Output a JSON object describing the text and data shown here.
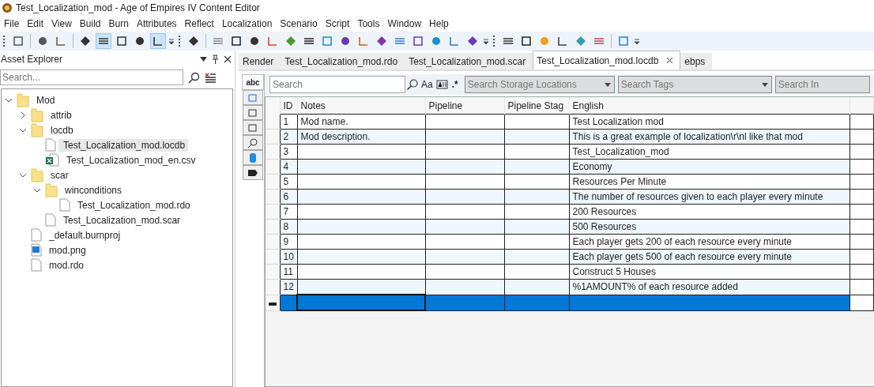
{
  "window": {
    "title": "Test_Localization_mod - Age of Empires IV Content Editor"
  },
  "menu": [
    "File",
    "Edit",
    "View",
    "Build",
    "Burn",
    "Attributes",
    "Reflect",
    "Localization",
    "Scenario",
    "Script",
    "Tools",
    "Window",
    "Help"
  ],
  "toolbar": [
    [
      {
        "pressed": false
      }
    ],
    [
      {
        "pressed": false
      },
      {
        "pressed": false
      }
    ],
    [
      {
        "pressed": false
      },
      {
        "pressed": true
      },
      {
        "pressed": false
      },
      {
        "pressed": false
      },
      {
        "pressed": true
      }
    ],
    [
      {
        "pressed": false
      }
    ],
    [
      {
        "pressed": false
      },
      {
        "pressed": false
      },
      {
        "pressed": false
      },
      {
        "pressed": false
      },
      {
        "pressed": false
      },
      {
        "pressed": false
      },
      {
        "pressed": false
      },
      {
        "pressed": false
      },
      {
        "pressed": false
      },
      {
        "pressed": false
      },
      {
        "pressed": false
      },
      {
        "pressed": false
      },
      {
        "pressed": false
      },
      {
        "pressed": false
      },
      {
        "pressed": false
      }
    ],
    [
      {
        "pressed": false
      },
      {
        "pressed": false
      },
      {
        "pressed": false
      },
      {
        "pressed": false
      },
      {
        "pressed": false
      },
      {
        "pressed": false
      }
    ],
    [
      {
        "pressed": false
      }
    ]
  ],
  "asset_explorer": {
    "title": "Asset Explorer",
    "search": {
      "placeholder": "Search..."
    },
    "tree": [
      {
        "label": "Mod",
        "kind": "folder",
        "expanded": true,
        "selected": false,
        "children": [
          {
            "label": "attrib",
            "kind": "folder",
            "expanded": false,
            "selected": false
          },
          {
            "label": "locdb",
            "kind": "folder",
            "expanded": true,
            "selected": false,
            "children": [
              {
                "label": "Test_Localization_mod.locdb",
                "kind": "file",
                "selected": true
              },
              {
                "label": "Test_Localization_mod_en.csv",
                "kind": "sheet",
                "selected": false
              }
            ]
          },
          {
            "label": "scar",
            "kind": "folder",
            "expanded": true,
            "selected": false,
            "children": [
              {
                "label": "winconditions",
                "kind": "folder",
                "expanded": true,
                "selected": false,
                "children": [
                  {
                    "label": "Test_Localization_mod.rdo",
                    "kind": "file",
                    "selected": false
                  }
                ]
              },
              {
                "label": "Test_Localization_mod.scar",
                "kind": "file",
                "selected": false
              }
            ]
          },
          {
            "label": "_default.burnproj",
            "kind": "file",
            "selected": false
          },
          {
            "label": "mod.png",
            "kind": "image",
            "selected": false
          },
          {
            "label": "mod.rdo",
            "kind": "file",
            "selected": false
          }
        ]
      }
    ]
  },
  "tabs": [
    {
      "label": "Render",
      "selected": false,
      "closable": false
    },
    {
      "label": "Test_Localization_mod.rdo",
      "selected": false,
      "closable": false
    },
    {
      "label": "Test_Localization_mod.scar",
      "selected": false,
      "closable": false
    },
    {
      "label": "Test_Localization_mod.locdb",
      "selected": true,
      "closable": true
    },
    {
      "label": "ebps",
      "selected": false,
      "closable": false
    }
  ],
  "side_tabs": [
    {
      "label": "abc",
      "selected": true
    }
  ],
  "search": {
    "placeholder": "Search",
    "case_label": "Aa",
    "regex_label": ".*"
  },
  "filters": [
    {
      "placeholder": "Search Storage Locations",
      "dropdown": true
    },
    {
      "placeholder": "Search Tags",
      "dropdown": true
    },
    {
      "placeholder": "Search In",
      "dropdown": false
    }
  ],
  "table": {
    "columns": [
      "ID",
      "Notes",
      "Pipeline",
      "Pipeline Stag",
      "English"
    ],
    "rows": [
      {
        "cells": [
          "1",
          "Mod name.",
          "",
          "",
          "Test Localization mod"
        ],
        "selected": false
      },
      {
        "cells": [
          "2",
          "Mod description.",
          "",
          "",
          "This is a great example of localization\\r\\nl like that mod"
        ],
        "selected": false
      },
      {
        "cells": [
          "3",
          "",
          "",
          "",
          "Test_Localization_mod"
        ],
        "selected": false
      },
      {
        "cells": [
          "4",
          "",
          "",
          "",
          "Economy"
        ],
        "selected": false
      },
      {
        "cells": [
          "5",
          "",
          "",
          "",
          "Resources Per Minute"
        ],
        "selected": false
      },
      {
        "cells": [
          "6",
          "",
          "",
          "",
          "The number of resources given to each player every minute"
        ],
        "selected": false
      },
      {
        "cells": [
          "7",
          "",
          "",
          "",
          "200 Resources"
        ],
        "selected": false
      },
      {
        "cells": [
          "8",
          "",
          "",
          "",
          "500 Resources"
        ],
        "selected": false
      },
      {
        "cells": [
          "9",
          "",
          "",
          "",
          "Each player gets 200 of each resource every minute"
        ],
        "selected": false
      },
      {
        "cells": [
          "10",
          "",
          "",
          "",
          "Each player gets 500 of each resource every minute"
        ],
        "selected": false
      },
      {
        "cells": [
          "11",
          "",
          "",
          "",
          "Construct 5 Houses"
        ],
        "selected": false
      },
      {
        "cells": [
          "12",
          "",
          "",
          "",
          "%1AMOUNT% of each resource added"
        ],
        "selected": false
      },
      {
        "cells": [],
        "selected": true
      }
    ]
  }
}
